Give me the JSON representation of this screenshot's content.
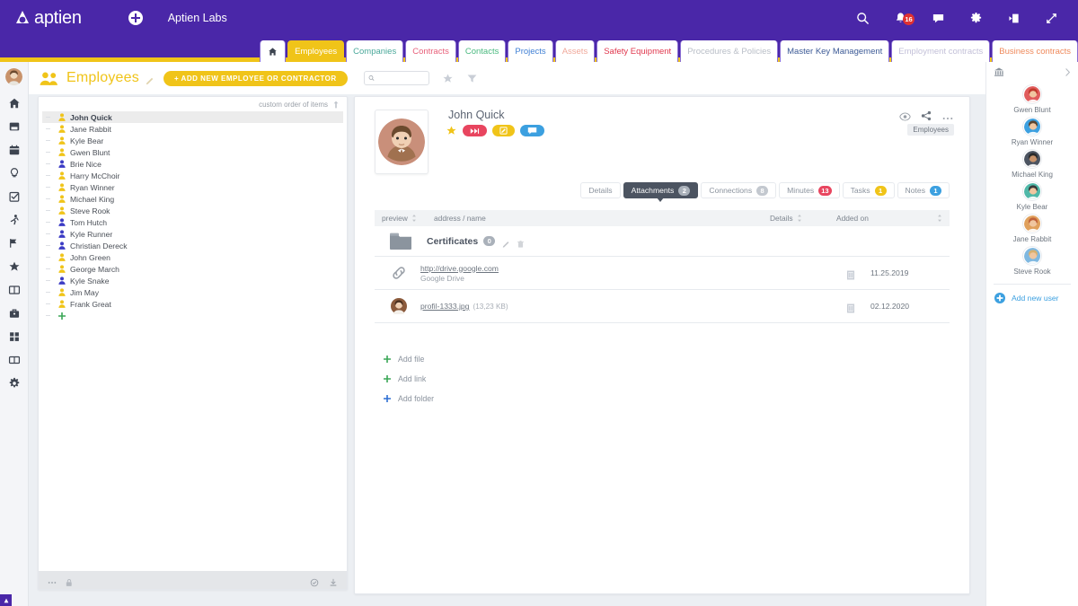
{
  "topbar": {
    "brand": "aptien",
    "workspace": "Aptien Labs",
    "add_icon": "plus-circle-icon",
    "icons": [
      {
        "name": "search-icon",
        "label": "Search"
      },
      {
        "name": "notifications-icon",
        "label": "Notifications",
        "badge": "16"
      },
      {
        "name": "chat-icon",
        "label": "Chat"
      },
      {
        "name": "settings-gear-icon",
        "label": "Settings"
      },
      {
        "name": "logout-icon",
        "label": "Log out"
      },
      {
        "name": "fullscreen-icon",
        "label": "Fullscreen"
      }
    ]
  },
  "module_tabs": [
    {
      "label": "",
      "name": "tab-home",
      "icon": "home-icon",
      "color": "#3d4450",
      "active": false
    },
    {
      "label": "Employees",
      "name": "tab-employees",
      "color": "#ffffff",
      "active": true
    },
    {
      "label": "Companies",
      "name": "tab-companies",
      "color": "#4aa89a",
      "active": false
    },
    {
      "label": "Contracts",
      "name": "tab-contracts",
      "color": "#e8607a",
      "active": false
    },
    {
      "label": "Contacts",
      "name": "tab-contacts",
      "color": "#4ab97f",
      "active": false
    },
    {
      "label": "Projects",
      "name": "tab-projects",
      "color": "#3f7fd4",
      "active": false
    },
    {
      "label": "Assets",
      "name": "tab-assets",
      "color": "#f0a89a",
      "active": false
    },
    {
      "label": "Safety Equipment",
      "name": "tab-safety-equipment",
      "color": "#e0384e",
      "active": false
    },
    {
      "label": "Procedures & Policies",
      "name": "tab-procedures-policies",
      "color": "#b9bec7",
      "active": false
    },
    {
      "label": "Master Key Management",
      "name": "tab-master-key-management",
      "color": "#3c5a96",
      "active": false
    },
    {
      "label": "Employment contracts",
      "name": "tab-employment-contracts",
      "color": "#c3c0d8",
      "active": false
    },
    {
      "label": "Business contracts",
      "name": "tab-business-contracts",
      "color": "#ef8a5c",
      "active": false
    }
  ],
  "rail": {
    "avatar": "user-avatar",
    "icons": [
      "home-icon",
      "inbox-icon",
      "calendar-icon",
      "lightbulb-icon",
      "checkbox-task-icon",
      "person-running-icon",
      "pin-flag-icon",
      "star-icon",
      "book-open-icon",
      "briefcase-icon",
      "grid-apps-icon",
      "book-icon",
      "gear-icon"
    ]
  },
  "page_header": {
    "icon": "people-group-icon",
    "title": "Employees",
    "edit_icon": "pencil-icon",
    "add_button": "+ ADD NEW EMPLOYEE OR CONTRACTOR",
    "search_placeholder": "",
    "search_value": "",
    "star_icon": "star-icon",
    "filter_icon": "filter-icon"
  },
  "list_panel": {
    "order_label": "custom order of items",
    "order_icon": "sort-arrow-icon",
    "employees": [
      {
        "name": "John Quick",
        "color": "#f0c419",
        "selected": true
      },
      {
        "name": "Jane Rabbit",
        "color": "#f0c419",
        "selected": false
      },
      {
        "name": "Kyle Bear",
        "color": "#f0c419",
        "selected": false
      },
      {
        "name": "Gwen Blunt",
        "color": "#f0c419",
        "selected": false
      },
      {
        "name": "Brie Nice",
        "color": "#3b3bc4",
        "selected": false
      },
      {
        "name": "Harry McChoir",
        "color": "#f0c419",
        "selected": false
      },
      {
        "name": "Ryan Winner",
        "color": "#f0c419",
        "selected": false
      },
      {
        "name": "Michael King",
        "color": "#f0c419",
        "selected": false
      },
      {
        "name": "Steve Rook",
        "color": "#f0c419",
        "selected": false
      },
      {
        "name": "Tom Hutch",
        "color": "#3b3bc4",
        "selected": false
      },
      {
        "name": "Kyle Runner",
        "color": "#3b3bc4",
        "selected": false
      },
      {
        "name": "Christian Dereck",
        "color": "#3b3bc4",
        "selected": false
      },
      {
        "name": "John Green",
        "color": "#f0c419",
        "selected": false
      },
      {
        "name": "George March",
        "color": "#f0c419",
        "selected": false
      },
      {
        "name": "Kyle Snake",
        "color": "#3b3bc4",
        "selected": false
      },
      {
        "name": "Jim May",
        "color": "#f0c419",
        "selected": false
      },
      {
        "name": "Frank Great",
        "color": "#f0c419",
        "selected": false
      }
    ],
    "add_icon": "plus-icon",
    "footer_icons": [
      "more-options-icon",
      "lock-icon",
      "check-circle-icon",
      "export-icon"
    ]
  },
  "detail": {
    "name": "John Quick",
    "avatar": "employee-avatar",
    "star_icon": "star-icon",
    "badges": [
      {
        "name": "fast-forward-badge",
        "icon": "fast-forward-icon",
        "color": "#e8455f"
      },
      {
        "name": "edit-badge",
        "icon": "edit-square-icon",
        "color": "#f0c419"
      },
      {
        "name": "comment-badge",
        "icon": "speech-bubble-icon",
        "color": "#3ca0e0"
      }
    ],
    "tools": [
      "eye-icon",
      "share-icon",
      "more-dots-icon"
    ],
    "entity_chip": "Employees",
    "tabs": [
      {
        "label": "Details",
        "name": "tab-details",
        "count": null,
        "active": false
      },
      {
        "label": "Attachments",
        "name": "tab-attachments",
        "count": "2",
        "count_style": "grey",
        "active": true
      },
      {
        "label": "Connections",
        "name": "tab-connections",
        "count": "8",
        "count_style": "lightgrey",
        "active": false
      },
      {
        "label": "Minutes",
        "name": "tab-minutes",
        "count": "13",
        "count_style": "red",
        "active": false
      },
      {
        "label": "Tasks",
        "name": "tab-tasks",
        "count": "1",
        "count_style": "yellow",
        "active": false
      },
      {
        "label": "Notes",
        "name": "tab-notes",
        "count": "1",
        "count_style": "blue",
        "active": false
      }
    ],
    "table": {
      "headers": [
        {
          "label": "preview",
          "name": "col-preview"
        },
        {
          "label": "address / name",
          "name": "col-address-name"
        },
        {
          "label": "Details",
          "name": "col-details"
        },
        {
          "label": "Added on",
          "name": "col-added-on"
        }
      ],
      "folder": {
        "icon": "folder-icon",
        "name": "Certificates",
        "count": "0",
        "edit_icon": "pencil-icon",
        "delete_icon": "trash-icon"
      },
      "rows": [
        {
          "icon": "link-chain-icon",
          "link": "http://drive.google.com",
          "subtitle": "Google Drive",
          "size": "",
          "details_icon": "document-icon",
          "added_on": "11.25.2019"
        },
        {
          "icon": "image-thumbnail-icon",
          "link": "profil-1333.jpg",
          "subtitle": "",
          "size": "(13,23 KB)",
          "details_icon": "document-icon",
          "added_on": "02.12.2020"
        }
      ]
    },
    "actions": [
      {
        "label": "Add file",
        "name": "add-file-button",
        "color": "#3aa757"
      },
      {
        "label": "Add link",
        "name": "add-link-button",
        "color": "#3aa757"
      },
      {
        "label": "Add folder",
        "name": "add-folder-button",
        "color": "#2d6fd4"
      }
    ]
  },
  "right_panel": {
    "head_icon": "organization-icon",
    "collapse_icon": "chevron-right-icon",
    "users": [
      {
        "name": "Gwen Blunt",
        "skin": "#f0c6a0",
        "hair": "#c0392b",
        "shirt": "#e05c5c"
      },
      {
        "name": "Ryan Winner",
        "skin": "#f0c6a0",
        "hair": "#5b4632",
        "shirt": "#3ca0e0"
      },
      {
        "name": "Michael King",
        "skin": "#c8926a",
        "hair": "#2b2b2b",
        "shirt": "#4c5461"
      },
      {
        "name": "Kyle Bear",
        "skin": "#f0c6a0",
        "hair": "#3a3a3a",
        "shirt": "#4fb8a8"
      },
      {
        "name": "Jane Rabbit",
        "skin": "#f0c6a0",
        "hair": "#c0623a",
        "shirt": "#e0a05c"
      },
      {
        "name": "Steve Rook",
        "skin": "#f0c6a0",
        "hair": "#d8b070",
        "shirt": "#7fb8e0"
      }
    ],
    "add_label": "Add new user",
    "add_icon": "plus-circle-icon"
  }
}
